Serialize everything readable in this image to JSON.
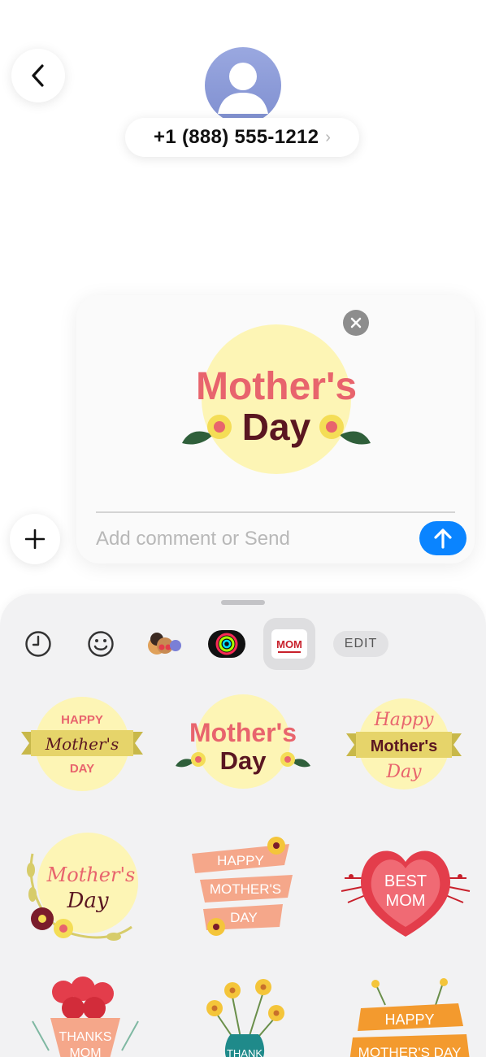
{
  "contact": {
    "name": "+1 (888) 555-1212",
    "chevron": "›"
  },
  "compose": {
    "preview_sticker": {
      "line1": "Mother's",
      "line2": "Day"
    },
    "comment_placeholder": "Add comment or Send"
  },
  "drawer": {
    "tabs": [
      {
        "name": "recents",
        "icon": "clock-icon"
      },
      {
        "name": "emoji",
        "icon": "smiley-icon"
      },
      {
        "name": "memoji",
        "icon": "memoji-icon"
      },
      {
        "name": "activity",
        "icon": "activity-rings-icon"
      },
      {
        "name": "mom-stickers",
        "icon_text": "MOM",
        "selected": true
      }
    ],
    "edit_label": "EDIT",
    "stickers": [
      {
        "lines": [
          "HAPPY",
          "Mother's",
          "DAY"
        ]
      },
      {
        "lines": [
          "Mother's",
          "Day"
        ]
      },
      {
        "lines": [
          "Happy",
          "Mother's",
          "Day"
        ]
      },
      {
        "lines": [
          "Mother's",
          "Day"
        ]
      },
      {
        "lines": [
          "HAPPY",
          "MOTHER'S",
          "DAY"
        ]
      },
      {
        "lines": [
          "BEST",
          "MOM"
        ]
      },
      {
        "lines": [
          "THANKS",
          "MOM"
        ]
      },
      {
        "lines": [
          "THANK"
        ]
      },
      {
        "lines": [
          "HAPPY",
          "MOTHER'S DAY"
        ]
      }
    ]
  },
  "colors": {
    "accent_blue": "#0a84ff",
    "sticker_yellow": "#fdf5b5",
    "sticker_pink": "#e8646d",
    "sticker_maroon": "#5a1621",
    "leaf_green": "#2f5f3a"
  }
}
